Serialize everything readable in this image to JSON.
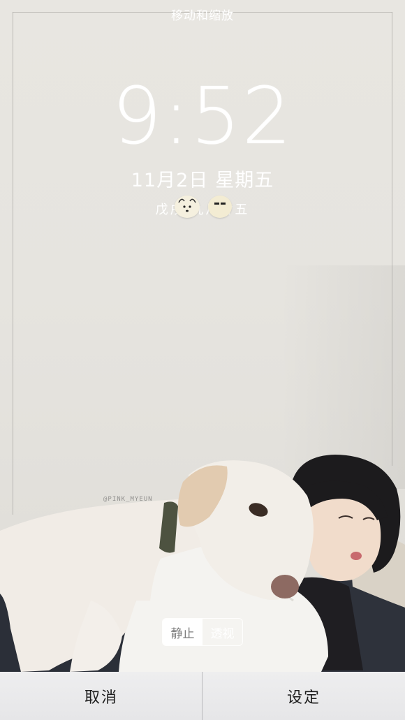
{
  "screen_title": "移动和缩放",
  "lock_screen": {
    "time": "9:52",
    "date": "11月2日",
    "weekday": "星期五",
    "lunar": "戊戌 九月廿五"
  },
  "photo": {
    "watermark": "@PINK_MYEUN"
  },
  "motion_toggle": {
    "still_label": "静止",
    "perspective_label": "透视",
    "selected": "静止"
  },
  "actions": {
    "cancel_label": "取消",
    "set_label": "设定"
  }
}
